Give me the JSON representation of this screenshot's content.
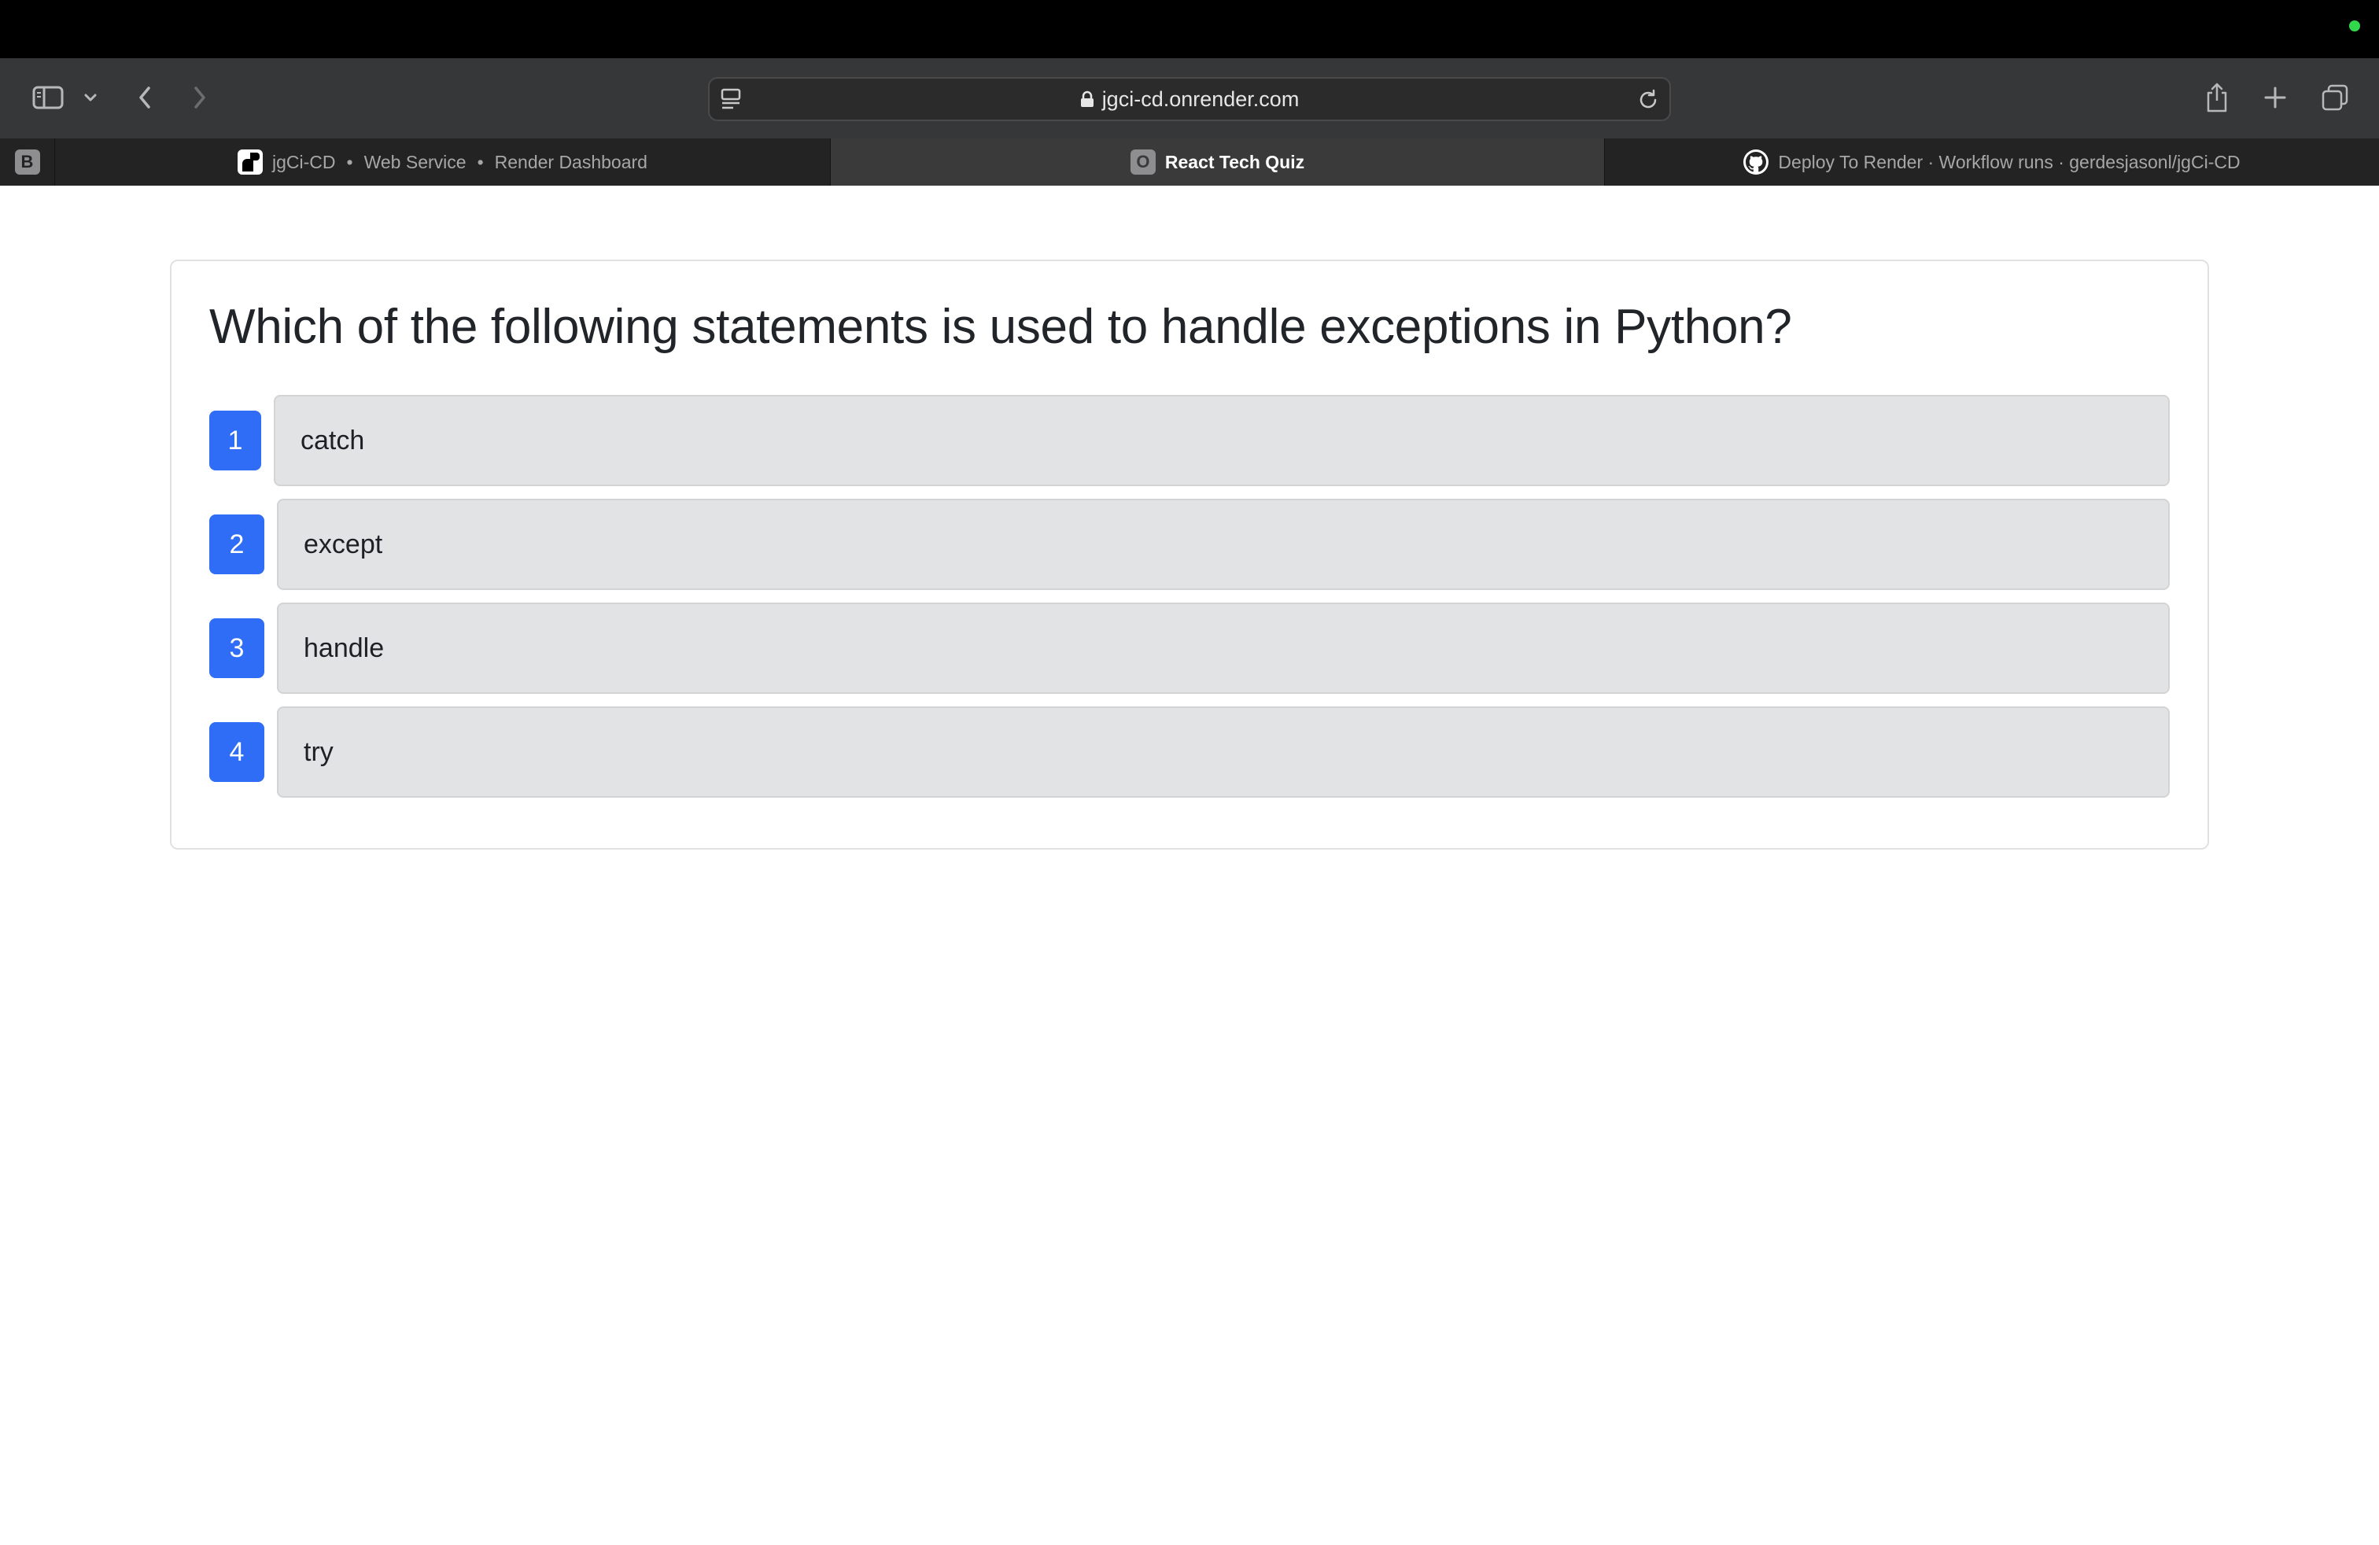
{
  "browser": {
    "url": "jgci-cd.onrender.com",
    "icons": {
      "sidebar": "sidebar-icon",
      "back": "chevron-left-icon",
      "forward": "chevron-right-icon",
      "share": "share-icon",
      "new_tab": "plus-icon",
      "tab_overview": "tab-overview-icon",
      "lock": "lock-icon",
      "reload": "reload-icon"
    },
    "tabs": [
      {
        "pinned_label": "B"
      },
      {
        "parts": [
          "jgCi-CD",
          "Web Service",
          "Render Dashboard"
        ],
        "separator": "•",
        "active": false
      },
      {
        "icon_letter": "O",
        "title": "React Tech Quiz",
        "active": true
      },
      {
        "title": "Deploy To Render · Workflow runs · gerdesjasonl/jgCi-CD",
        "active": false
      }
    ]
  },
  "quiz": {
    "question": "Which of the following statements is used to handle exceptions in Python?",
    "options": [
      {
        "number": "1",
        "text": "catch"
      },
      {
        "number": "2",
        "text": "except"
      },
      {
        "number": "3",
        "text": "handle"
      },
      {
        "number": "4",
        "text": "try"
      }
    ]
  },
  "colors": {
    "option_badge": "#2f6df6",
    "option_bg": "#e2e3e5",
    "toolbar_bg": "#363738",
    "active_tab_bg": "#3a3a3b"
  }
}
